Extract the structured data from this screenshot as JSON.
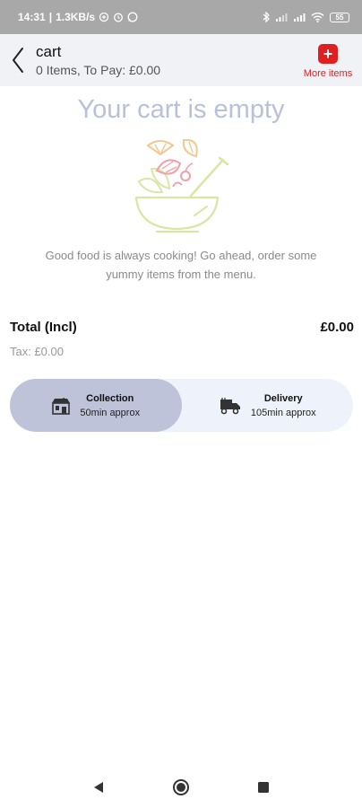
{
  "status_bar": {
    "time": "14:31",
    "speed": "1.3KB/s",
    "battery": "55"
  },
  "header": {
    "title": "cart",
    "subtitle": "0 Items, To Pay: £0.00",
    "more_items_label": "More items",
    "accent_color": "#e02020"
  },
  "empty_state": {
    "title": "Your cart is empty",
    "message": "Good food is always cooking! Go ahead, order some yummy items from the menu."
  },
  "totals": {
    "total_label": "Total (Incl)",
    "total_value": "£0.00",
    "tax_text": "Tax: £0.00"
  },
  "order_type": {
    "selected": "collection",
    "collection": {
      "name": "Collection",
      "time": "50min approx"
    },
    "delivery": {
      "name": "Delivery",
      "time": "105min approx"
    }
  },
  "nav": {
    "icons": [
      "back-triangle-icon",
      "home-circle-icon",
      "recents-square-icon"
    ]
  }
}
